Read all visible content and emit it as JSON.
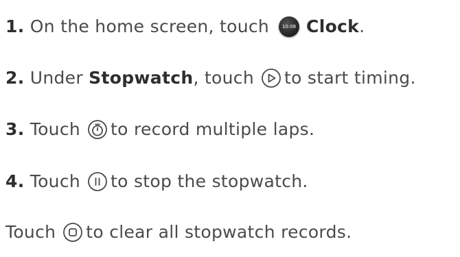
{
  "steps": [
    {
      "number": "1.",
      "text_before": "On the home screen, touch",
      "app_icon_text": "10:08",
      "bold": "Clock",
      "text_after": "."
    },
    {
      "number": "2.",
      "text_before": "Under",
      "bold": "Stopwatch",
      "text_mid": ", touch",
      "icon": "play-icon",
      "text_after": "to start timing."
    },
    {
      "number": "3.",
      "text_before": "Touch",
      "icon": "lap-timer-icon",
      "text_after": "to record multiple laps."
    },
    {
      "number": "4.",
      "text_before": "Touch",
      "icon": "pause-icon",
      "text_after": "to stop the stopwatch."
    }
  ],
  "note": {
    "text_before": "Touch",
    "icon": "reset-icon",
    "text_after": "to clear all stopwatch records."
  }
}
